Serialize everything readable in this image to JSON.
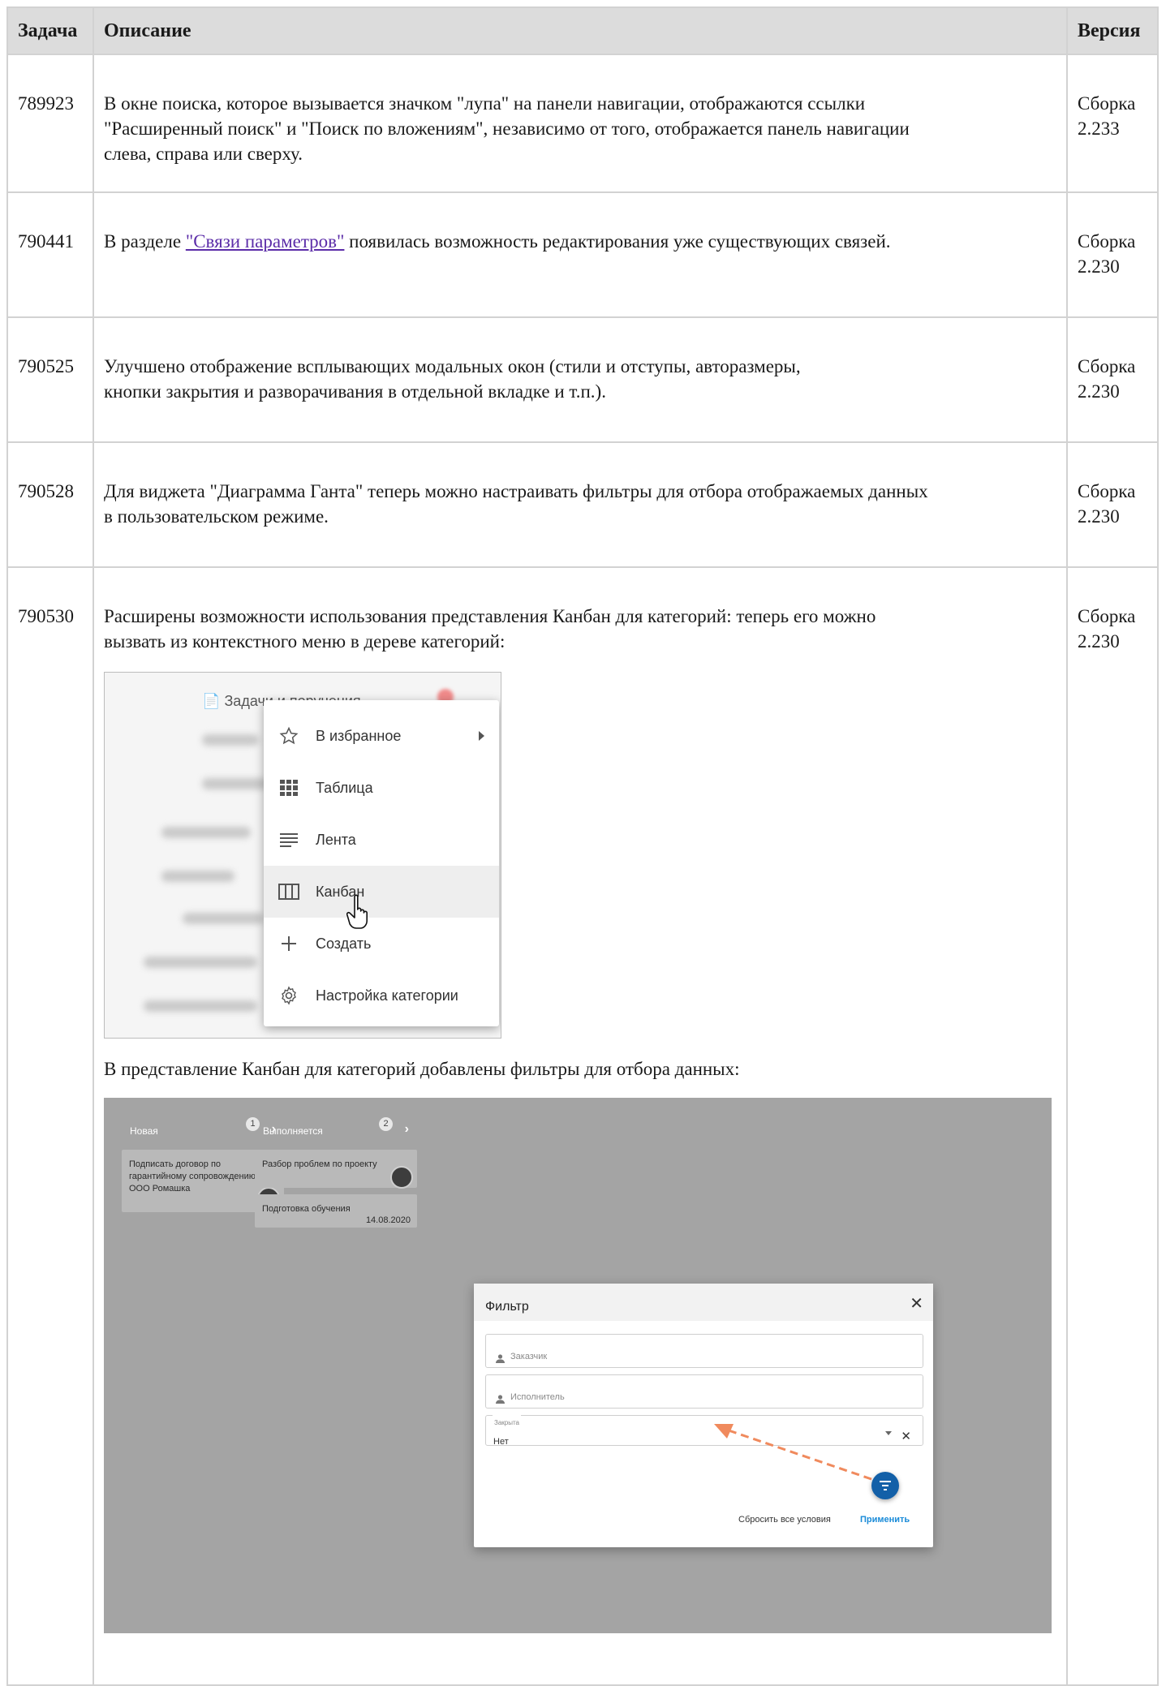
{
  "table": {
    "headers": {
      "task": "Задача",
      "description": "Описание",
      "version": "Версия"
    },
    "rows": [
      {
        "task": "789923",
        "description": "В окне поиска, которое вызывается значком \"лупа\" на панели навигации, отображаются ссылки\n\"Расширенный поиск\" и \"Поиск по вложениям\", независимо от того, отображается панель навигации\nслева, справа или сверху.",
        "version": "Сборка\n2.233"
      },
      {
        "task": "790441",
        "description_before": "В разделе ",
        "description_link": "\"Связи параметров\"",
        "description_after": " появилась возможность редактирования уже существующих связей.",
        "version": "Сборка\n2.230"
      },
      {
        "task": "790525",
        "description": "Улучшено отображение всплывающих модальных окон (стили и отступы, авторазмеры,\nкнопки закрытия и разворачивания в отдельной вкладке и т.п.).",
        "version": "Сборка\n2.230"
      },
      {
        "task": "790528",
        "description": "Для виджета \"Диаграмма Ганта\" теперь можно настраивать фильтры для отбора отображаемых данных\nв пользовательском режиме.",
        "version": "Сборка\n2.230"
      },
      {
        "task": "790530",
        "description": "Расширены возможности использования представления Канбан для категорий: теперь его можно\nвызвать из контекстного меню в дереве категорий:",
        "caption2": "В представление Канбан для категорий добавлены фильтры для отбора данных:",
        "version": "Сборка\n2.230"
      }
    ]
  },
  "context_menu_shot": {
    "tree_item": "Задачи и поручения",
    "menu_items": [
      {
        "label": "В избранное",
        "icon": "star-outline-icon",
        "submenu": true
      },
      {
        "label": "Таблица",
        "icon": "grid-icon"
      },
      {
        "label": "Лента",
        "icon": "list-lines-icon"
      },
      {
        "label": "Канбан",
        "icon": "kanban-columns-icon",
        "highlighted": true
      },
      {
        "label": "Создать",
        "icon": "plus-icon"
      },
      {
        "label": "Настройка категории",
        "icon": "gear-icon"
      }
    ]
  },
  "kanban_shot": {
    "columns": [
      {
        "title": "Новая",
        "count": "1",
        "color": "#1a78c2"
      },
      {
        "title": "Выполняется",
        "count": "2",
        "color": "#0f4d86"
      }
    ],
    "cards": [
      {
        "text": "Подписать договор по гарантийному сопровождению с ООО Ромашка"
      },
      {
        "text": "Разбор проблем по проекту"
      },
      {
        "text": "Подготовка обучения",
        "date": "14.08.2020"
      }
    ],
    "filter_dialog": {
      "title": "Фильтр",
      "customer_placeholder": "Заказчик",
      "executor_placeholder": "Исполнитель",
      "closed_label": "Закрыта",
      "closed_value": "Нет",
      "reset_label": "Сбросить все условия",
      "apply_label": "Применить"
    }
  }
}
